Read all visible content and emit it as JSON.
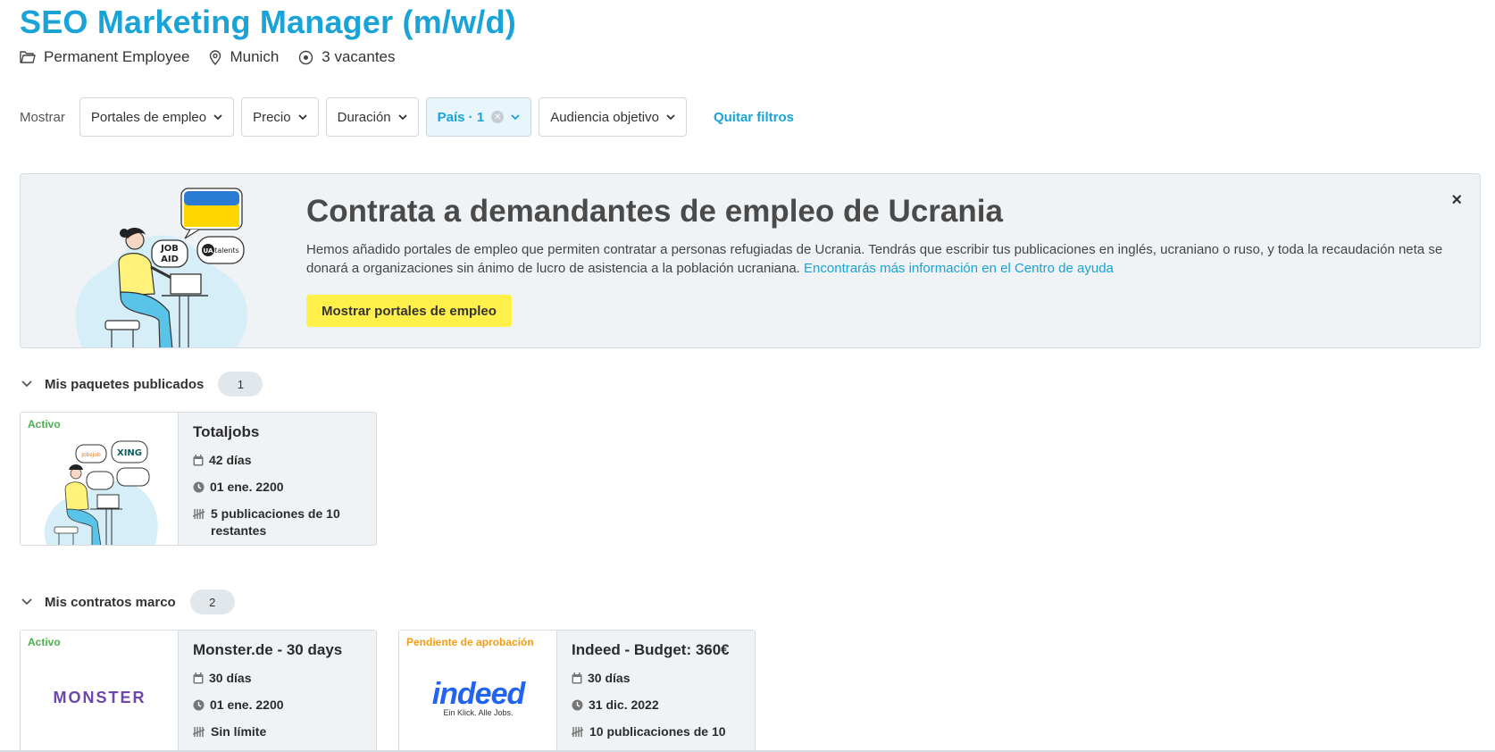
{
  "job": {
    "title": "SEO Marketing Manager (m/w/d)",
    "type": "Permanent Employee",
    "location": "Munich",
    "vacancies": "3 vacantes"
  },
  "filters": {
    "label": "Mostrar",
    "items": [
      {
        "label": "Portales de empleo"
      },
      {
        "label": "Precio"
      },
      {
        "label": "Duración"
      },
      {
        "label": "País · 1",
        "active": true
      },
      {
        "label": "Audiencia objetivo"
      }
    ],
    "clear_label": "Quitar filtros"
  },
  "banner": {
    "title": "Contrata a demandantes de empleo de Ucrania",
    "text": "Hemos añadido portales de empleo que permiten contratar a personas refugiadas de Ucrania. Tendrás que escribir tus publicaciones en inglés, ucraniano o ruso, y toda la recaudación neta se donará a organizaciones sin ánimo de lucro de asistencia a la población ucraniana. ",
    "link": "Encontrarás más información en el Centro de ayuda",
    "button": "Mostrar portales de empleo",
    "close": "×",
    "illus_badges": {
      "jobaid_top": "JOB",
      "jobaid_bottom": "AID",
      "ua": "UA",
      "talents": "talents"
    }
  },
  "sections": {
    "packages": {
      "title": "Mis paquetes publicados",
      "count": "1",
      "cards": [
        {
          "status": "Activo",
          "title": "Totaljobs",
          "duration": "42 días",
          "date": "01 ene. 2200",
          "quota": "5 publicaciones de 10 restantes",
          "illus": {
            "xing": "XING",
            "jobsjob": "JobsJob"
          }
        }
      ]
    },
    "contracts": {
      "title": "Mis contratos marco",
      "count": "2",
      "cards": [
        {
          "status": "Activo",
          "title": "Monster.de - 30 days",
          "duration": "30 días",
          "date": "01 ene. 2200",
          "quota": "Sin límite",
          "logo": "MONSTER"
        },
        {
          "status": "Pendiente de aprobación",
          "title": "Indeed - Budget: 360€",
          "duration": "30 días",
          "date": "31 dic. 2022",
          "quota": "10 publicaciones de 10",
          "logo": "indeed",
          "logo_tag": "Ein Klick. Alle Jobs."
        }
      ]
    }
  },
  "colors": {
    "accent": "#1aa3d6",
    "button_yellow": "#fff04a",
    "active_green": "#4caf50",
    "pending_orange": "#f39c12",
    "monster_purple": "#6e46ae",
    "indeed_blue": "#2164f3"
  }
}
